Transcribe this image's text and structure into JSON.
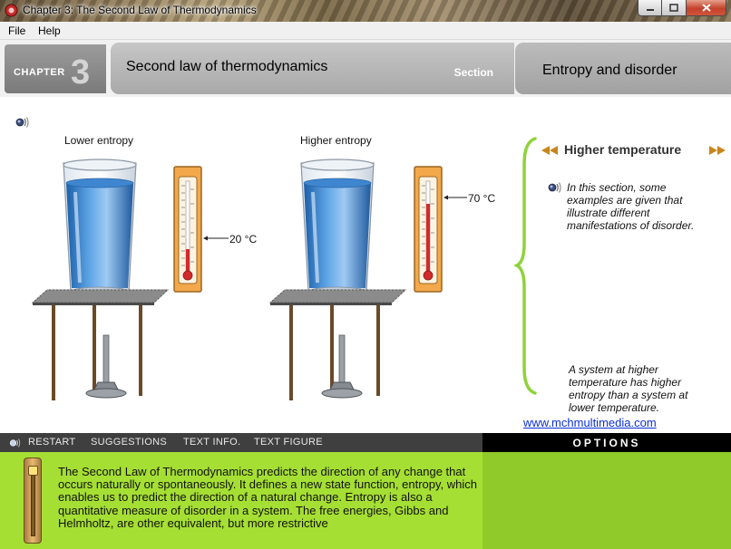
{
  "window": {
    "title": "Chapter 3: The Second Law of Thermodynamics"
  },
  "menu": {
    "file": "File",
    "help": "Help"
  },
  "header": {
    "chapter_label": "CHAPTER",
    "chapter_number": "3",
    "page_title": "Second law of thermodynamics",
    "section_label": "Section",
    "section_title": "Entropy and disorder"
  },
  "figure": {
    "left_label": "Lower entropy",
    "right_label": "Higher entropy",
    "left_temp": "20 °C",
    "right_temp": "70 °C"
  },
  "side_panel": {
    "title": "Higher temperature",
    "intro": [
      "In this section, some",
      "examples are given that",
      "illustrate different",
      "manifestations of disorder."
    ],
    "caption": [
      "A system at higher",
      "temperature has higher",
      "entropy than a system at",
      "lower temperature."
    ],
    "website": "www.mchmultimedia.com"
  },
  "toolbar": {
    "restart": "RESTART",
    "suggestions": "SUGGESTIONS",
    "text_info": "TEXT INFO.",
    "text_figure": "TEXT FIGURE",
    "options": "OPTIONS"
  },
  "body_text": "The Second Law of Thermodynamics predicts the direction of any change that occurs naturally or spontaneously.  It defines a new state function, entropy, which enables us to predict the direction of a natural change. Entropy is also a quantitative measure of disorder in a system.  The free energies, Gibbs and Helmholtz, are other equivalent, but more restrictive",
  "colors": {
    "accent_green": "#a5df33",
    "thermometer_frame": "#f3a94b",
    "mercury": "#d22a2a",
    "link": "#0b2fd6"
  },
  "icons": {
    "app": "app-icon",
    "audio": "speaker-icon",
    "prev": "double-left-arrow-icon",
    "next": "double-right-arrow-icon"
  }
}
